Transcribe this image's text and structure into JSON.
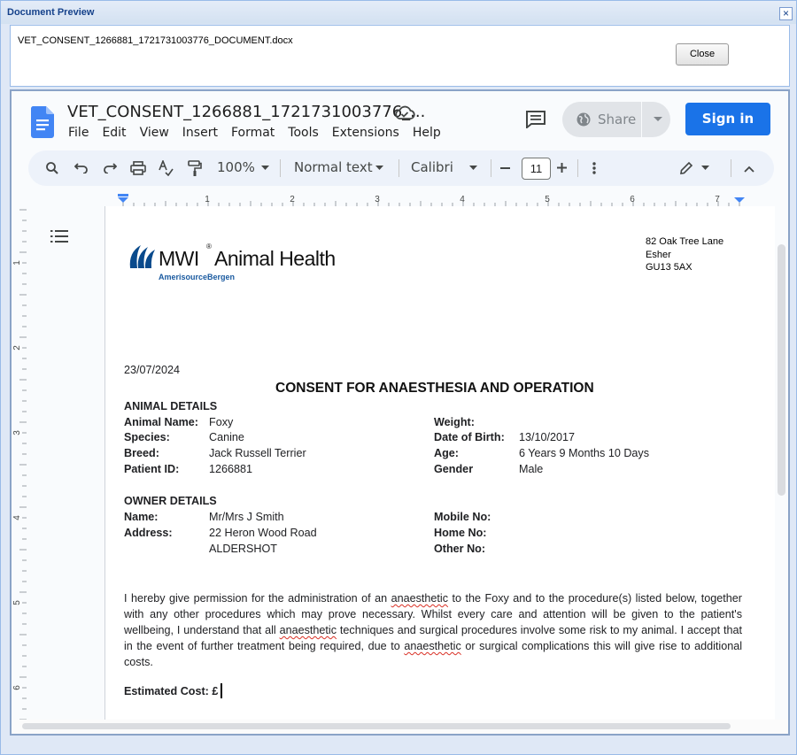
{
  "dialog": {
    "title": "Document Preview",
    "close_x": "×"
  },
  "info": {
    "filename": "VET_CONSENT_1266881_1721731003776_DOCUMENT.docx",
    "close_label": "Close"
  },
  "gdocs": {
    "doc_title": "VET_CONSENT_1266881_1721731003776_...",
    "menu": [
      "File",
      "Edit",
      "View",
      "Insert",
      "Format",
      "Tools",
      "Extensions",
      "Help"
    ],
    "share_label": "Share",
    "signin_label": "Sign in",
    "zoom": "100%",
    "style": "Normal text",
    "font": "Calibri",
    "font_size": "11",
    "ruler_numbers": [
      "1",
      "2",
      "3",
      "4",
      "5",
      "6",
      "7"
    ],
    "vruler_numbers": [
      "1",
      "2",
      "3",
      "4",
      "5",
      "6"
    ],
    "accent": "#1a73e8"
  },
  "document": {
    "logo_text": "MWI",
    "logo_suffix": "Animal Health",
    "logo_sub": "AmerisourceBergen",
    "address": [
      "82 Oak Tree Lane",
      "Esher",
      "GU13 5AX"
    ],
    "date": "23/07/2024",
    "heading": "CONSENT FOR ANAESTHESIA AND OPERATION",
    "animal_section": "ANIMAL DETAILS",
    "animal_left": [
      {
        "label": "Animal Name:",
        "value": "Foxy"
      },
      {
        "label": "Species:",
        "value": "Canine"
      },
      {
        "label": "Breed:",
        "value": "Jack Russell Terrier"
      },
      {
        "label": "Patient ID:",
        "value": "1266881"
      }
    ],
    "animal_right": [
      {
        "label": "Weight:",
        "value": ""
      },
      {
        "label": "Date of Birth:",
        "value": "13/10/2017"
      },
      {
        "label": "Age:",
        "value": "6 Years 9 Months 10 Days"
      },
      {
        "label": "Gender",
        "value": "Male"
      }
    ],
    "owner_section": "OWNER DETAILS",
    "owner_left": [
      {
        "label": "Name:",
        "value": "Mr/Mrs J Smith"
      },
      {
        "label": "Address:",
        "value": "22 Heron Wood Road"
      },
      {
        "label": "",
        "value": "ALDERSHOT"
      }
    ],
    "owner_right": [
      {
        "label": "Mobile No:",
        "value": ""
      },
      {
        "label": "Home No:",
        "value": ""
      },
      {
        "label": "Other No:",
        "value": ""
      }
    ],
    "para": {
      "s1": "I hereby give permission for the administration of an ",
      "w1": "anaesthetic",
      "s2": " to the Foxy and to the procedure(s) listed below, together with any other procedures which may prove necessary. Whilst every care and attention will be given to the patient's wellbeing, I understand that all ",
      "w2": "anaesthetic",
      "s3": " techniques and surgical procedures involve some risk to my animal. I accept that in the event of further treatment being required, due to ",
      "w3": "anaesthetic",
      "s4": " or surgical complications this will give rise to additional costs."
    },
    "cost_label": "Estimated Cost: £"
  }
}
